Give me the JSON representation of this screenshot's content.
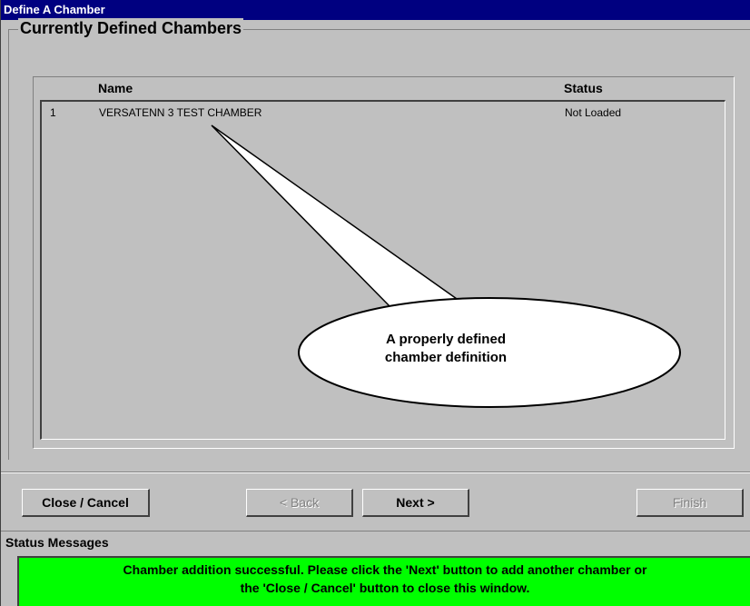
{
  "window": {
    "title": "Define A Chamber"
  },
  "group": {
    "title": "Currently Defined Chambers"
  },
  "list": {
    "columns": [
      "Name",
      "Status"
    ],
    "rows": [
      {
        "num": "1",
        "name": "VERSATENN 3 TEST CHAMBER",
        "status": "Not Loaded"
      }
    ]
  },
  "callout": {
    "line1": "A properly defined",
    "line2": "chamber definition"
  },
  "buttons": {
    "close": "Close / Cancel",
    "back": "< Back",
    "next": "Next >",
    "finish": "Finish"
  },
  "status": {
    "label": "Status Messages",
    "line1": "Chamber addition successful. Please click the 'Next' button to add another chamber or",
    "line2": "the 'Close / Cancel' button to close this window."
  },
  "colors": {
    "titlebar": "#000080",
    "status_bg": "#00ff00",
    "window_bg": "#c0c0c0"
  }
}
